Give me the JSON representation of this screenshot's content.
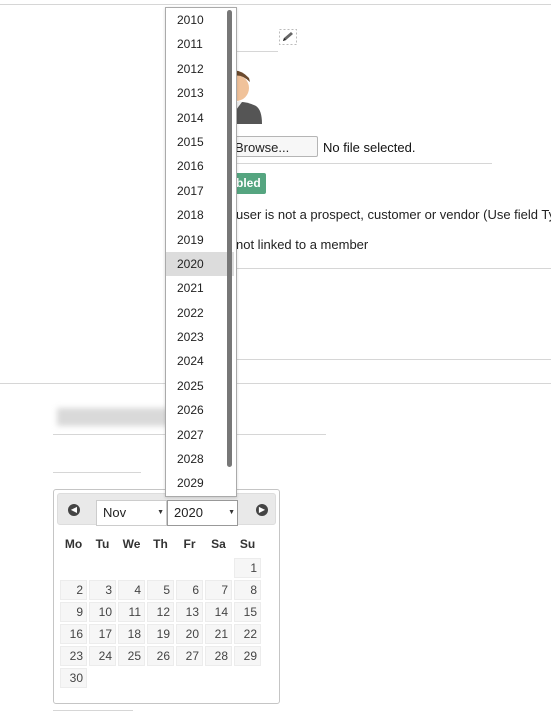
{
  "form": {
    "browse_label": "Browse...",
    "no_file_text": "No file selected.",
    "badge_text": "bled",
    "line1": "user is not a prospect, customer or vendor (Use field Ty",
    "line2": "not linked to a member"
  },
  "year_dropdown": {
    "years": [
      "2010",
      "2011",
      "2012",
      "2013",
      "2014",
      "2015",
      "2016",
      "2017",
      "2018",
      "2019",
      "2020",
      "2021",
      "2022",
      "2023",
      "2024",
      "2025",
      "2026",
      "2027",
      "2028",
      "2029"
    ],
    "selected": "2020"
  },
  "datepicker": {
    "month_value": "Nov",
    "year_value": "2020",
    "weekdays": [
      "Mo",
      "Tu",
      "We",
      "Th",
      "Fr",
      "Sa",
      "Su"
    ],
    "weeks": [
      [
        "",
        "",
        "",
        "",
        "",
        "",
        "1"
      ],
      [
        "2",
        "3",
        "4",
        "5",
        "6",
        "7",
        "8"
      ],
      [
        "9",
        "10",
        "11",
        "12",
        "13",
        "14",
        "15"
      ],
      [
        "16",
        "17",
        "18",
        "19",
        "20",
        "21",
        "22"
      ],
      [
        "23",
        "24",
        "25",
        "26",
        "27",
        "28",
        "29"
      ],
      [
        "30",
        "",
        "",
        "",
        "",
        "",
        ""
      ]
    ]
  },
  "icons": {
    "edit": "pencil-icon",
    "prev": "prev-arrow-icon",
    "next": "next-arrow-icon"
  }
}
